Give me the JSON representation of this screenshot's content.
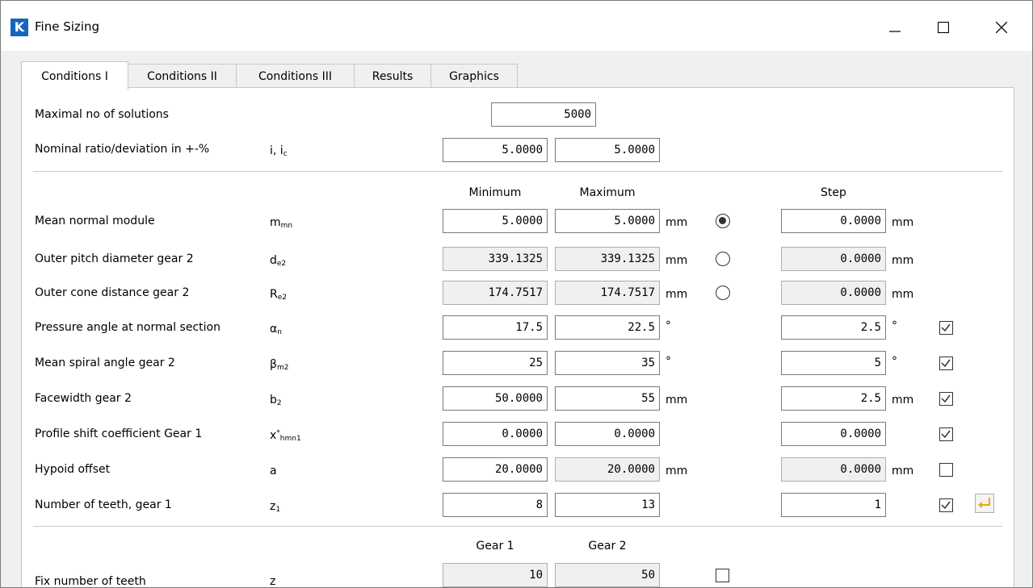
{
  "window": {
    "title": "Fine Sizing",
    "icon_letter": "K"
  },
  "tabs": [
    "Conditions I",
    "Conditions II",
    "Conditions III",
    "Results",
    "Graphics"
  ],
  "max_solutions": {
    "label": "Maximal no of solutions",
    "value": "5000"
  },
  "ratio": {
    "label": "Nominal ratio/deviation in +-%",
    "symbol": "i, i",
    "symbol_sub": "c",
    "value1": "5.0000",
    "value2": "5.0000"
  },
  "headers": {
    "min": "Minimum",
    "max": "Maximum",
    "step": "Step"
  },
  "rows": [
    {
      "label": "Mean normal module",
      "sym": "m",
      "sub": "mn",
      "min": "5.0000",
      "max": "5.0000",
      "unit": "mm",
      "step": "0.0000",
      "step_unit": "mm"
    },
    {
      "label": "Outer pitch diameter gear 2",
      "sym": "d",
      "sub": "e2",
      "min": "339.1325",
      "max": "339.1325",
      "unit": "mm",
      "step": "0.0000",
      "step_unit": "mm"
    },
    {
      "label": "Outer cone distance gear 2",
      "sym": "R",
      "sub": "e2",
      "min": "174.7517",
      "max": "174.7517",
      "unit": "mm",
      "step": "0.0000",
      "step_unit": "mm"
    },
    {
      "label": "Pressure angle at normal section",
      "sym": "α",
      "sub": "n",
      "min": "17.5",
      "max": "22.5",
      "unit": "°",
      "step": "2.5",
      "step_unit": "°"
    },
    {
      "label": "Mean spiral angle gear 2",
      "sym": "β",
      "sub": "m2",
      "min": "25",
      "max": "35",
      "unit": "°",
      "step": "5",
      "step_unit": "°"
    },
    {
      "label": "Facewidth gear 2",
      "sym": "b",
      "sub": "2",
      "min": "50.0000",
      "max": "55",
      "unit": "mm",
      "step": "2.5",
      "step_unit": "mm"
    },
    {
      "label": "Profile shift coefficient Gear 1",
      "sym": "x",
      "sup": "*",
      "sub": "hmn1",
      "min": "0.0000",
      "max": "0.0000",
      "unit": "",
      "step": "0.0000",
      "step_unit": ""
    },
    {
      "label": "Hypoid offset",
      "sym": "a",
      "sub": "",
      "min": "20.0000",
      "max": "20.0000",
      "unit": "mm",
      "step": "0.0000",
      "step_unit": "mm"
    },
    {
      "label": "Number of teeth, gear 1",
      "sym": "z",
      "sub": "1",
      "min": "8",
      "max": "13",
      "unit": "",
      "step": "1",
      "step_unit": ""
    }
  ],
  "gear_headers": {
    "gear1": "Gear 1",
    "gear2": "Gear 2"
  },
  "fix_teeth": {
    "label": "Fix number of teeth",
    "sym": "z",
    "gear1": "10",
    "gear2": "50"
  },
  "colors": {
    "accent": "#1565c0",
    "arrow": "#f0a800"
  }
}
